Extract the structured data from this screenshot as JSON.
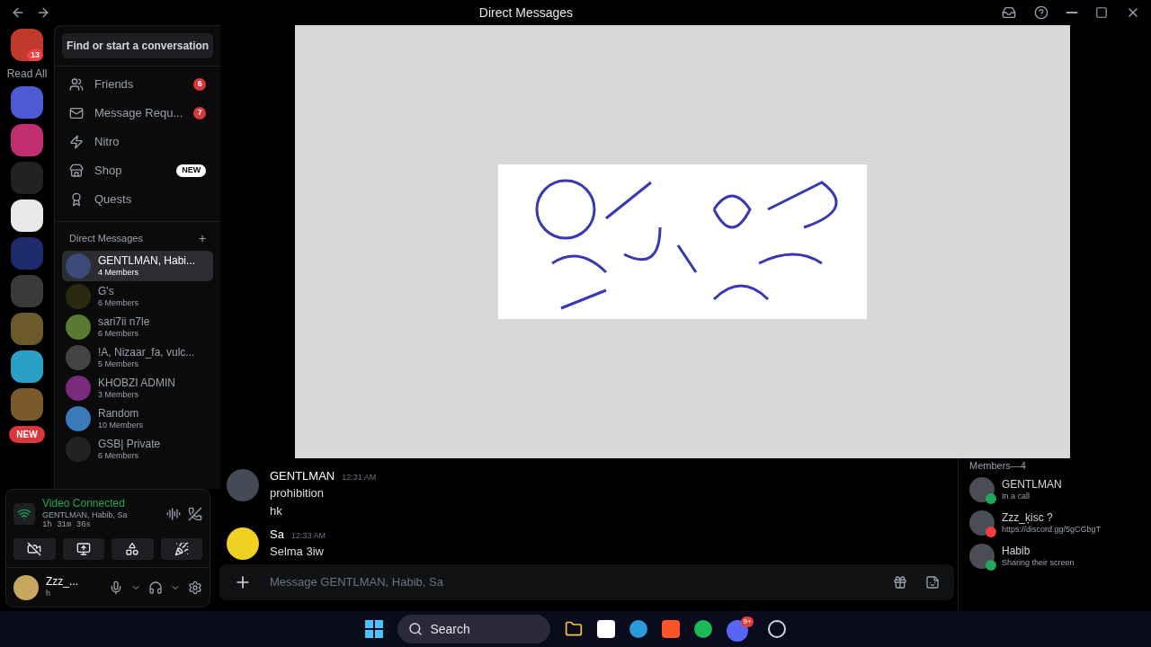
{
  "window": {
    "title": "Direct Messages"
  },
  "server_rail": {
    "badge": "13",
    "read_all": "Read All",
    "new_badge": "NEW",
    "servers": [
      {
        "color": "#4f5bd5"
      },
      {
        "color": "#c03070"
      },
      {
        "color": "#222222"
      },
      {
        "color": "#e8e8e8"
      },
      {
        "color": "#1d2a6b"
      },
      {
        "color": "#3a3a3a"
      },
      {
        "color": "#6b5a2a"
      },
      {
        "color": "#2aa0c8"
      },
      {
        "color": "#7a5a2a"
      }
    ]
  },
  "sidebar": {
    "search": "Find or start a conversation",
    "nav": [
      {
        "label": "Friends",
        "badge": "6",
        "kind": "count"
      },
      {
        "label": "Message Requ...",
        "badge": "7",
        "kind": "count"
      },
      {
        "label": "Nitro",
        "kind": "plain"
      },
      {
        "label": "Shop",
        "badge": "NEW",
        "kind": "new"
      },
      {
        "label": "Quests",
        "kind": "plain"
      }
    ],
    "dm_heading": "Direct Messages",
    "add": "+",
    "dms": [
      {
        "name": "GENTLMAN, Habi...",
        "sub": "4 Members",
        "selected": true,
        "color": "#3b4a7a"
      },
      {
        "name": "G's",
        "sub": "6 Members",
        "selected": false,
        "color": "#2a2a10"
      },
      {
        "name": "sari7ii n7le",
        "sub": "6 Members",
        "selected": false,
        "color": "#5a7a30"
      },
      {
        "name": "!A, Nizaar_fa, vulc...",
        "sub": "5 Members",
        "selected": false,
        "color": "#444444"
      },
      {
        "name": "KHOBZI ADMIN",
        "sub": "3 Members",
        "selected": false,
        "color": "#7a2a7a"
      },
      {
        "name": "Random",
        "sub": "10 Members",
        "selected": false,
        "color": "#3a7ab8"
      },
      {
        "name": "GSB| Private",
        "sub": "6 Members",
        "selected": false,
        "color": "#222222"
      }
    ]
  },
  "voice": {
    "status": "Video Connected",
    "channel": "GENTLMAN, Habib, Sa",
    "time": "1h 31m 36s"
  },
  "user": {
    "name": "Zzz_...",
    "status": "h"
  },
  "messages": [
    {
      "author": "GENTLMAN",
      "time": "12:31 AM",
      "lines": [
        "prohibition",
        "hk"
      ],
      "color": "#444a55"
    },
    {
      "author": "Sa",
      "time": "12:33 AM",
      "lines": [
        "Selma 3iw"
      ],
      "color": "#f0d020"
    }
  ],
  "composer": {
    "placeholder": "Message GENTLMAN, Habib, Sa"
  },
  "members": {
    "heading": "Members—4",
    "list": [
      {
        "name": "GENTLMAN",
        "activity": "In a call",
        "color": "#23a55a"
      },
      {
        "name": "Zzz_ķisc ?",
        "activity": "https://discord.gg/5gCGbgT",
        "color": "#f23f43"
      },
      {
        "name": "Habib",
        "activity": "Sharing their screen",
        "color": "#23a55a"
      }
    ]
  },
  "taskbar": {
    "search": "Search",
    "discord_badge": "9+"
  }
}
